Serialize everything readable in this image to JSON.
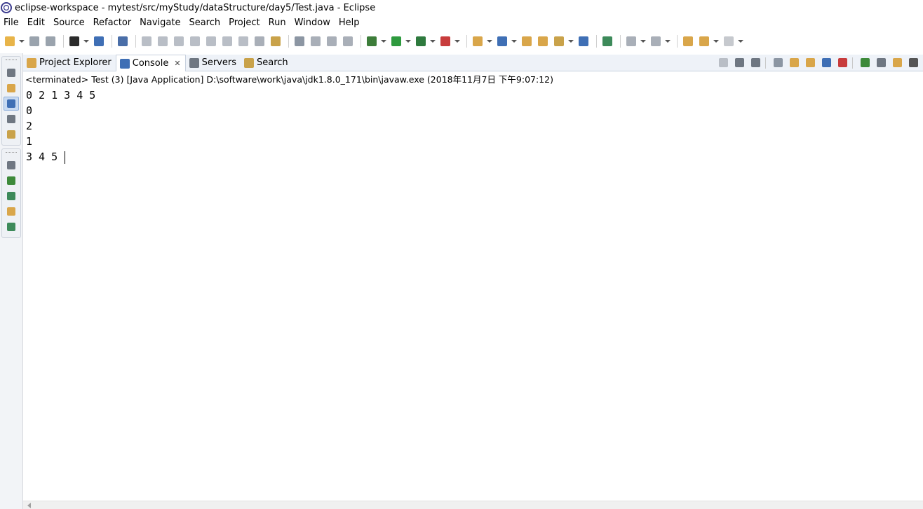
{
  "window": {
    "title": "eclipse-workspace - mytest/src/myStudy/dataStructure/day5/Test.java - Eclipse"
  },
  "menu": [
    "File",
    "Edit",
    "Source",
    "Refactor",
    "Navigate",
    "Search",
    "Project",
    "Run",
    "Window",
    "Help"
  ],
  "toolbar": {
    "icons": [
      {
        "name": "new-icon",
        "color": "#e8b449",
        "dropdown": true
      },
      {
        "name": "save-icon",
        "color": "#9aa3ad",
        "dropdown": false
      },
      {
        "name": "save-all-icon",
        "color": "#9aa3ad",
        "dropdown": false
      },
      {
        "name": "account-icon",
        "color": "#2b2b2b",
        "dropdown": true
      },
      {
        "name": "terminal-icon",
        "color": "#3f6fb5",
        "dropdown": false
      },
      {
        "name": "skip-breakpoints-icon",
        "color": "#4a6ea8",
        "dropdown": false
      },
      {
        "name": "resume-icon",
        "color": "#b9bec6",
        "dropdown": false
      },
      {
        "name": "suspend-icon",
        "color": "#b9bec6",
        "dropdown": false
      },
      {
        "name": "terminate-icon",
        "color": "#b9bec6",
        "dropdown": false
      },
      {
        "name": "disconnect-icon",
        "color": "#b9bec6",
        "dropdown": false
      },
      {
        "name": "step-into-icon",
        "color": "#b9bec6",
        "dropdown": false
      },
      {
        "name": "step-over-icon",
        "color": "#b9bec6",
        "dropdown": false
      },
      {
        "name": "step-return-icon",
        "color": "#b9bec6",
        "dropdown": false
      },
      {
        "name": "drop-to-frame-icon",
        "color": "#a9afb8",
        "dropdown": false
      },
      {
        "name": "use-step-filters-icon",
        "color": "#c9a24a",
        "dropdown": false
      },
      {
        "name": "toggle-breakpoint-icon",
        "color": "#8c96a3",
        "dropdown": false
      },
      {
        "name": "toggle-watchpoint-icon",
        "color": "#a9afb8",
        "dropdown": false
      },
      {
        "name": "toggle-method-breakpoint-icon",
        "color": "#a9afb8",
        "dropdown": false
      },
      {
        "name": "toggle-class-load-icon",
        "color": "#a9afb8",
        "dropdown": false
      },
      {
        "name": "debug-icon",
        "color": "#3d7d3a",
        "dropdown": true
      },
      {
        "name": "run-icon",
        "color": "#2e9a3e",
        "dropdown": true
      },
      {
        "name": "coverage-icon",
        "color": "#2e7a3e",
        "dropdown": true
      },
      {
        "name": "external-tools-icon",
        "color": "#c83c3c",
        "dropdown": true
      },
      {
        "name": "new-java-package-icon",
        "color": "#d9a64a",
        "dropdown": true
      },
      {
        "name": "new-java-class-icon",
        "color": "#3f6fb5",
        "dropdown": true
      },
      {
        "name": "open-type-icon",
        "color": "#d9a64a",
        "dropdown": false
      },
      {
        "name": "open-task-icon",
        "color": "#d9a64a",
        "dropdown": false
      },
      {
        "name": "search-icon",
        "color": "#c9a24a",
        "dropdown": true
      },
      {
        "name": "globe-icon",
        "color": "#3f6fb5",
        "dropdown": false
      },
      {
        "name": "perspective-icon",
        "color": "#3d8a5a",
        "dropdown": false
      },
      {
        "name": "next-annotation-icon",
        "color": "#a9afb8",
        "dropdown": true
      },
      {
        "name": "previous-annotation-icon",
        "color": "#a9afb8",
        "dropdown": true
      },
      {
        "name": "last-edit-location-icon",
        "color": "#d9a64a",
        "dropdown": false
      },
      {
        "name": "back-icon",
        "color": "#d9a64a",
        "dropdown": true
      },
      {
        "name": "forward-icon",
        "color": "#c6c9ce",
        "dropdown": true
      }
    ]
  },
  "left_trim": {
    "group1": [
      {
        "name": "restore-icon",
        "color": "#6f7782",
        "active": false
      },
      {
        "name": "package-explorer-icon",
        "color": "#d9a64a",
        "active": false
      },
      {
        "name": "console-icon",
        "color": "#3f6fb5",
        "active": true
      },
      {
        "name": "servers-icon",
        "color": "#6f7782",
        "active": false
      },
      {
        "name": "search-view-icon",
        "color": "#c9a24a",
        "active": false
      }
    ],
    "group2": [
      {
        "name": "restore-icon",
        "color": "#6f7782",
        "active": false
      },
      {
        "name": "outline-icon",
        "color": "#3d8a3a",
        "active": false
      },
      {
        "name": "task-list-icon",
        "color": "#3d8a5a",
        "active": false
      },
      {
        "name": "git-icon",
        "color": "#d9a64a",
        "active": false
      },
      {
        "name": "debug-view-icon",
        "color": "#3d8a5a",
        "active": false
      }
    ]
  },
  "tabs": [
    {
      "label": "Project Explorer",
      "icon": "project-explorer-icon",
      "color": "#d9a64a",
      "active": false
    },
    {
      "label": "Console",
      "icon": "console-icon",
      "color": "#3f6fb5",
      "active": true,
      "close": "✕"
    },
    {
      "label": "Servers",
      "icon": "servers-icon",
      "color": "#6f7782",
      "active": false
    },
    {
      "label": "Search",
      "icon": "search-icon",
      "color": "#c9a24a",
      "active": false
    }
  ],
  "view_actions": [
    {
      "name": "terminate-icon",
      "color": "#b9bec6"
    },
    {
      "name": "remove-launch-icon",
      "color": "#6f7782"
    },
    {
      "name": "remove-all-terminated-icon",
      "color": "#6f7782"
    },
    {
      "name": "clear-console-icon",
      "color": "#8c96a3"
    },
    {
      "name": "scroll-lock-icon",
      "color": "#d9a64a"
    },
    {
      "name": "word-wrap-icon",
      "color": "#d9a64a"
    },
    {
      "name": "show-on-output-icon",
      "color": "#3f6fb5"
    },
    {
      "name": "show-on-error-icon",
      "color": "#c83c3c"
    },
    {
      "name": "pin-console-icon",
      "color": "#3d8a3a"
    },
    {
      "name": "display-selected-console-icon",
      "color": "#6f7782"
    },
    {
      "name": "open-console-icon",
      "color": "#d9a64a"
    },
    {
      "name": "view-menu-icon",
      "color": "#555555"
    }
  ],
  "console": {
    "header": "<terminated> Test (3) [Java Application] D:\\software\\work\\java\\jdk1.8.0_171\\bin\\javaw.exe (2018年11月7日 下午9:07:12)",
    "lines": [
      "0 2 1 3 4 5",
      "0",
      "2",
      "1",
      "3 4 5 "
    ]
  }
}
